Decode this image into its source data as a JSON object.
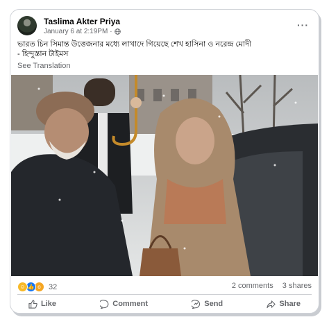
{
  "post": {
    "author": "Taslima Akter Priya",
    "timestamp": "January 6 at 2:19PM",
    "separator": "·",
    "text_line1": "ভারত চিন সিমান্ত উত্তেজনার মধ্যে লাখাদে গিয়েছে শেখ হাসিনা ও নরেন্দ্র মোদী",
    "text_line2": "- হিন্দুস্তান টাইমস",
    "see_translation": "See Translation",
    "more_label": "···"
  },
  "stats": {
    "reaction_count": "32",
    "comments": "2 comments",
    "shares": "3 shares"
  },
  "actions": {
    "like": "Like",
    "comment": "Comment",
    "send": "Send",
    "share": "Share"
  },
  "colors": {
    "text": "#050505",
    "secondary": "#65676b",
    "divider": "#ced0d4",
    "like_blue": "#1877f2"
  },
  "icons": [
    "globe-icon",
    "more-icon",
    "haha-reaction-icon",
    "like-reaction-icon",
    "wow-reaction-icon",
    "like-icon",
    "comment-icon",
    "send-icon",
    "share-icon"
  ]
}
